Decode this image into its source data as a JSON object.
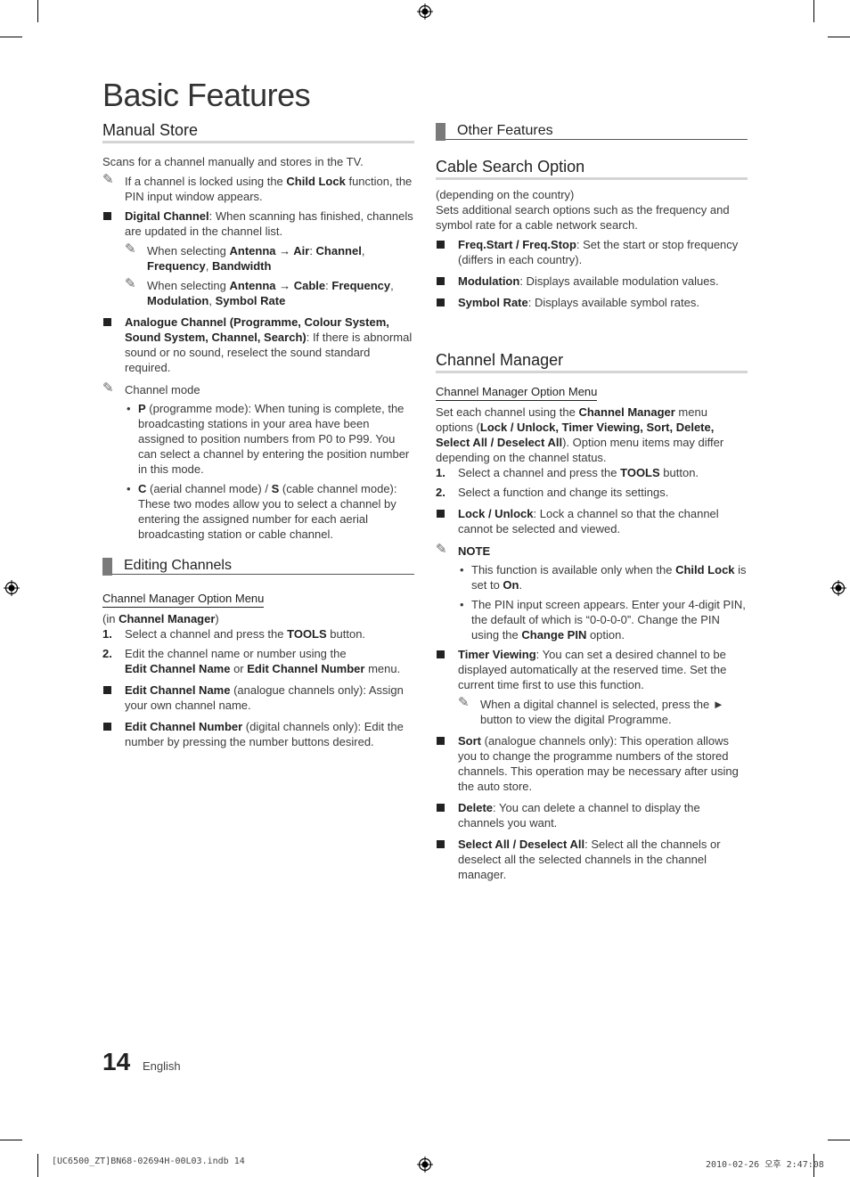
{
  "page": {
    "title": "Basic Features",
    "page_number": "14",
    "language": "English",
    "slug_left": "[UC6500_ZT]BN68-02694H-00L03.indb   14",
    "slug_right": "2010-02-26   오후 2:47:08"
  },
  "left": {
    "manual_store": {
      "heading": "Manual Store",
      "intro": "Scans for a channel manually and stores in the TV.",
      "note1": {
        "pre": "If a channel is locked using the ",
        "b1": "Child Lock",
        "post": " function, the PIN input window appears."
      },
      "digital": {
        "label": "Digital Channel",
        "text": ": When scanning has finished, channels are updated in the channel list.",
        "note_air": {
          "pre": "When selecting ",
          "b1": "Antenna",
          "arrow": " → ",
          "b2": "Air",
          "sep": ": ",
          "b3": "Channel",
          "c1": ", ",
          "b4": "Frequency",
          "c2": ", ",
          "b5": "Bandwidth"
        },
        "note_cable": {
          "pre": "When selecting ",
          "b1": "Antenna",
          "arrow": " → ",
          "b2": "Cable",
          "sep": ": ",
          "b3": "Frequency",
          "c1": ", ",
          "b4": "Modulation",
          "c2": ", ",
          "b5": "Symbol Rate"
        }
      },
      "analogue": {
        "label": "Analogue Channel (Programme, Colour System, Sound System, Channel, Search)",
        "text": ": If there is abnormal sound or no sound, reselect the sound standard required."
      },
      "channel_mode": {
        "label": "Channel mode",
        "p": {
          "b": "P",
          "text": " (programme mode): When tuning is complete, the broadcasting stations in your area have been assigned to position numbers from P0 to P99. You can select a channel by entering the position number in this mode."
        },
        "cs": {
          "b1": "C",
          "mid": " (aerial channel mode) / ",
          "b2": "S",
          "text": " (cable channel mode): These two modes allow you to select a channel by entering the assigned number for each aerial broadcasting station or cable channel."
        }
      }
    },
    "editing": {
      "heading": "Editing Channels",
      "menu_title": "Channel Manager Option Menu",
      "in_pre": "(in ",
      "in_b": "Channel Manager",
      "in_post": ")",
      "steps": [
        {
          "n": "1.",
          "pre": "Select a channel and press the ",
          "b": "TOOLS",
          "post": " button."
        },
        {
          "n": "2.",
          "pre": "Edit the channel name or number using the ",
          "b": "Edit Channel Name",
          "mid": " or ",
          "b2": "Edit Channel Number",
          "post": " menu."
        }
      ],
      "items": [
        {
          "label": "Edit Channel Name",
          "text": " (analogue channels only): Assign your own channel name."
        },
        {
          "label": "Edit Channel Number",
          "text": " (digital channels only): Edit the number by pressing the number buttons desired."
        }
      ]
    }
  },
  "right": {
    "other_features": {
      "heading": "Other Features"
    },
    "cable_search": {
      "heading": "Cable Search Option",
      "note": "(depending on the country)",
      "intro": "Sets additional search options such as the frequency and symbol rate for a cable network search.",
      "items": [
        {
          "label": "Freq.Start / Freq.Stop",
          "text": ": Set the start or stop frequency (differs in each country)."
        },
        {
          "label": "Modulation",
          "text": ": Displays available modulation values."
        },
        {
          "label": "Symbol Rate",
          "text": ": Displays available symbol rates."
        }
      ]
    },
    "channel_manager": {
      "heading": "Channel Manager",
      "menu_title": "Channel Manager Option Menu",
      "intro": {
        "pre": "Set each channel using the ",
        "b1": "Channel Manager",
        "mid": " menu options (",
        "b2": "Lock / Unlock, Timer Viewing, Sort, Delete, Select All / Deselect All",
        "post": "). Option menu items may differ depending on the channel status."
      },
      "steps": [
        {
          "n": "1.",
          "pre": "Select a channel and press the ",
          "b": "TOOLS",
          "post": " button."
        },
        {
          "n": "2.",
          "pre": "Select a function and change its settings."
        }
      ],
      "lock": {
        "label": "Lock / Unlock",
        "text": ": Lock a channel so that the channel cannot be selected and viewed."
      },
      "note": {
        "label": "NOTE",
        "b1": {
          "pre": "This function is available only when the ",
          "b": "Child Lock",
          "mid": " is set to ",
          "b2": "On",
          "post": "."
        },
        "b2": {
          "pre": "The PIN input screen appears. Enter your 4-digit PIN, the default of which is “0-0-0-0”. Change the PIN using the ",
          "b": "Change PIN",
          "post": " option."
        }
      },
      "timer": {
        "label": "Timer Viewing",
        "text": ": You can set a desired channel to be displayed automatically at the reserved time. Set the current time first to use this function.",
        "note": "When a digital channel is selected, press the ► button to view the digital Programme."
      },
      "sort": {
        "label": "Sort",
        "text": " (analogue channels only): This operation allows you to change the programme numbers of the stored channels. This operation may be necessary after using the auto store."
      },
      "delete": {
        "label": "Delete",
        "text": ": You can delete a channel to display the channels you want."
      },
      "select_all": {
        "label": "Select All / Deselect All",
        "text": ": Select all the channels or deselect all the selected channels in the channel manager."
      }
    }
  },
  "icons": {
    "pencil": "✎",
    "bullet": "•"
  }
}
